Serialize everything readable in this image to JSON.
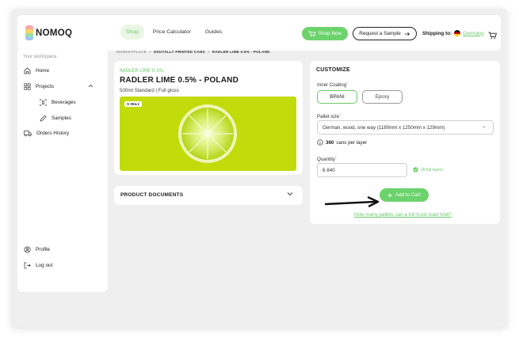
{
  "header": {
    "logo_text": "NOMOQ",
    "nav": [
      "Shop",
      "Price Calculator",
      "Guides"
    ],
    "shop_now": "Shop Now",
    "request_sample": "Request a Sample",
    "shipping_label": "Shipping to:",
    "shipping_country": "Germany",
    "cart_icon": "cart-icon"
  },
  "sidebar": {
    "workspace_label": "Your workspace",
    "items": {
      "home": "Home",
      "projects": "Projects",
      "beverages": "Beverages",
      "samples": "Samples",
      "orders": "Orders History",
      "profile": "Profile",
      "logout": "Log out"
    }
  },
  "breadcrumb": [
    "MARKETPLACE",
    "DIGITALLY PRINTED CANS",
    "RADLER LIME 0.5% - POLAND"
  ],
  "product": {
    "category": "RADLER LIME 0.5%",
    "title": "RADLER LIME 0.5% - POLAND",
    "subtitle": "500ml Standard | Full gloss",
    "sku": "S 004.1"
  },
  "documents": {
    "title": "PRODUCT DOCUMENTS"
  },
  "customize": {
    "title": "CUSTOMIZE",
    "inner_coating_label": "Inner Coating",
    "coating_options": [
      "BPANI",
      "Epoxy"
    ],
    "selected_coating": "BPANI",
    "pallet_size_label": "Pallet size",
    "pallet_size_value": "German, wood, one way (1180mm x 1250mm x 129mm)",
    "cans_per_layer_count": "360",
    "cans_per_layer_text": "cans per layer",
    "quantity_label": "Quantity",
    "quantity_value": "6 840",
    "full_layers": "18 full layers",
    "add_to_cart": "Add to Cart",
    "pallets_link": "How many pallets can a full truck load hold?"
  },
  "colors": {
    "accent_green": "#6cd36c",
    "product_bg": "#c2db0a",
    "app_bg": "#efefef"
  }
}
